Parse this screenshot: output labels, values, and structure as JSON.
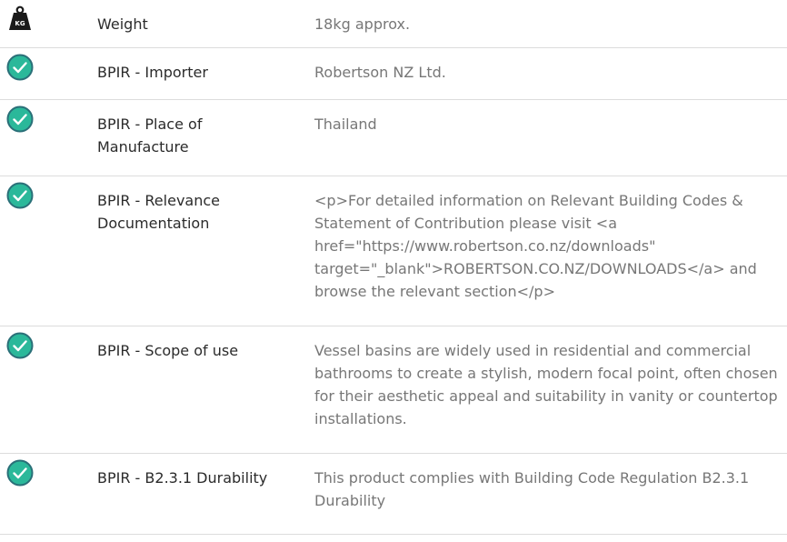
{
  "specs": [
    {
      "icon": "weight-kg-icon",
      "label": "Weight",
      "value": "18kg approx."
    },
    {
      "icon": "check-circle-icon",
      "label": "BPIR - Importer",
      "value": "Robertson NZ Ltd."
    },
    {
      "icon": "check-circle-icon",
      "label": "BPIR - Place of Manufacture",
      "value": "Thailand"
    },
    {
      "icon": "check-circle-icon",
      "label": "BPIR - Relevance Documentation",
      "value": "<p>For detailed information on Relevant Building Codes & Statement of Contribution please visit <a href=\"https://www.robertson.co.nz/downloads\" target=\"_blank\">ROBERTSON.CO.NZ/DOWNLOADS</a> and browse the relevant section</p>"
    },
    {
      "icon": "check-circle-icon",
      "label": "BPIR - Scope of use",
      "value": "Vessel basins are widely used in residential and commercial bathrooms to create a stylish, modern focal point, often chosen for their aesthetic appeal and suitability in vanity or countertop installations."
    },
    {
      "icon": "check-circle-icon",
      "label": "BPIR - B2.3.1 Durability",
      "value": "This product complies with Building Code Regulation B2.3.1 Durability"
    }
  ],
  "colors": {
    "check_fill": "#2bb89a",
    "check_ring": "#2a6f78",
    "weight_fill": "#1a1a1a",
    "divider": "#dcdcdc",
    "label_text": "#2b2b2b",
    "value_text": "#777777"
  }
}
